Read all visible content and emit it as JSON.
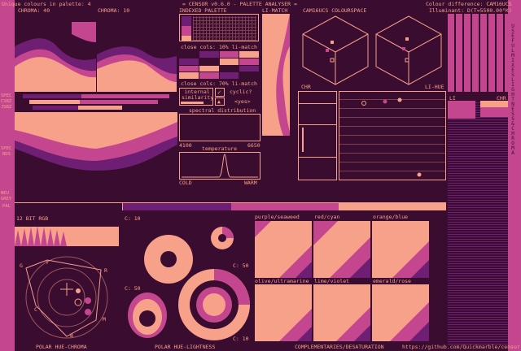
{
  "header": {
    "unique_colours": "Unique colours in palette: 4",
    "title": "= CENSOR v0.6.0 - PALETTE ANALYSER =",
    "colour_difference": "Colour difference: CAM16UCS",
    "illuminant": "Illuminant: D(T=5500.00°K)"
  },
  "labels": {
    "chroma_40": "CHROMA: 40",
    "chroma_10": "CHROMA: 10",
    "indexed_palette": "INDEXED PALETTE",
    "li_match": "LI-MATCH",
    "cam16ucs": "CAM16UCS COLOURSPACE",
    "close_cols_1": "close cols: 10% li-match",
    "close_cols_2": "close cols: 70% li-match",
    "internal_similarity": "internal similarity",
    "cyclic": "cyclic?",
    "yes": "<yes>",
    "spectral_distribution": "spectral distribution",
    "nm_start": "4100",
    "nm_end": "6650",
    "temperature": "temperature",
    "cold": "COLD",
    "warm": "WARM",
    "chr": "CHR",
    "li_hue": "LI-HUE",
    "li": "LI",
    "chr2": "CHR",
    "spec": "SPEC",
    "csbz": "CSBZ",
    "jsbz": "JSBZ",
    "spec2": "SPEC",
    "bds": "BDS",
    "neu": "NEU",
    "grey": "GREY",
    "pal": "PAL",
    "bit_rgb": "12 BIT RGB",
    "c10_a": "C: 10",
    "c50_a": "C: 50",
    "c50_b": "C: 50",
    "c10_b": "C: 10",
    "purple_seaweed": "purple/seaweed",
    "red_cyan": "red/cyan",
    "orange_blue": "orange/blue",
    "olive_ultramarine": "olive/ultramarine",
    "lime_violet": "lime/violet",
    "emerald_rose": "emerald/rose",
    "polar_hue_chroma": "POLAR HUE-CHROMA",
    "polar_hue_lightness": "POLAR HUE-LIGHTNESS",
    "complementaries": "COMPLEMENTARIES/DESATURATION",
    "github": "https://github.com/Quickmarble/censor",
    "side_right": "USEFUL MIXES   LIGHTNESS & CHROMA",
    "hue_labels": [
      "G",
      "Y",
      "R",
      "C",
      "M",
      "B"
    ]
  },
  "palette": {
    "colors": [
      "#3a0c30",
      "#6e1e73",
      "#c4468f",
      "#f7a08a"
    ]
  }
}
